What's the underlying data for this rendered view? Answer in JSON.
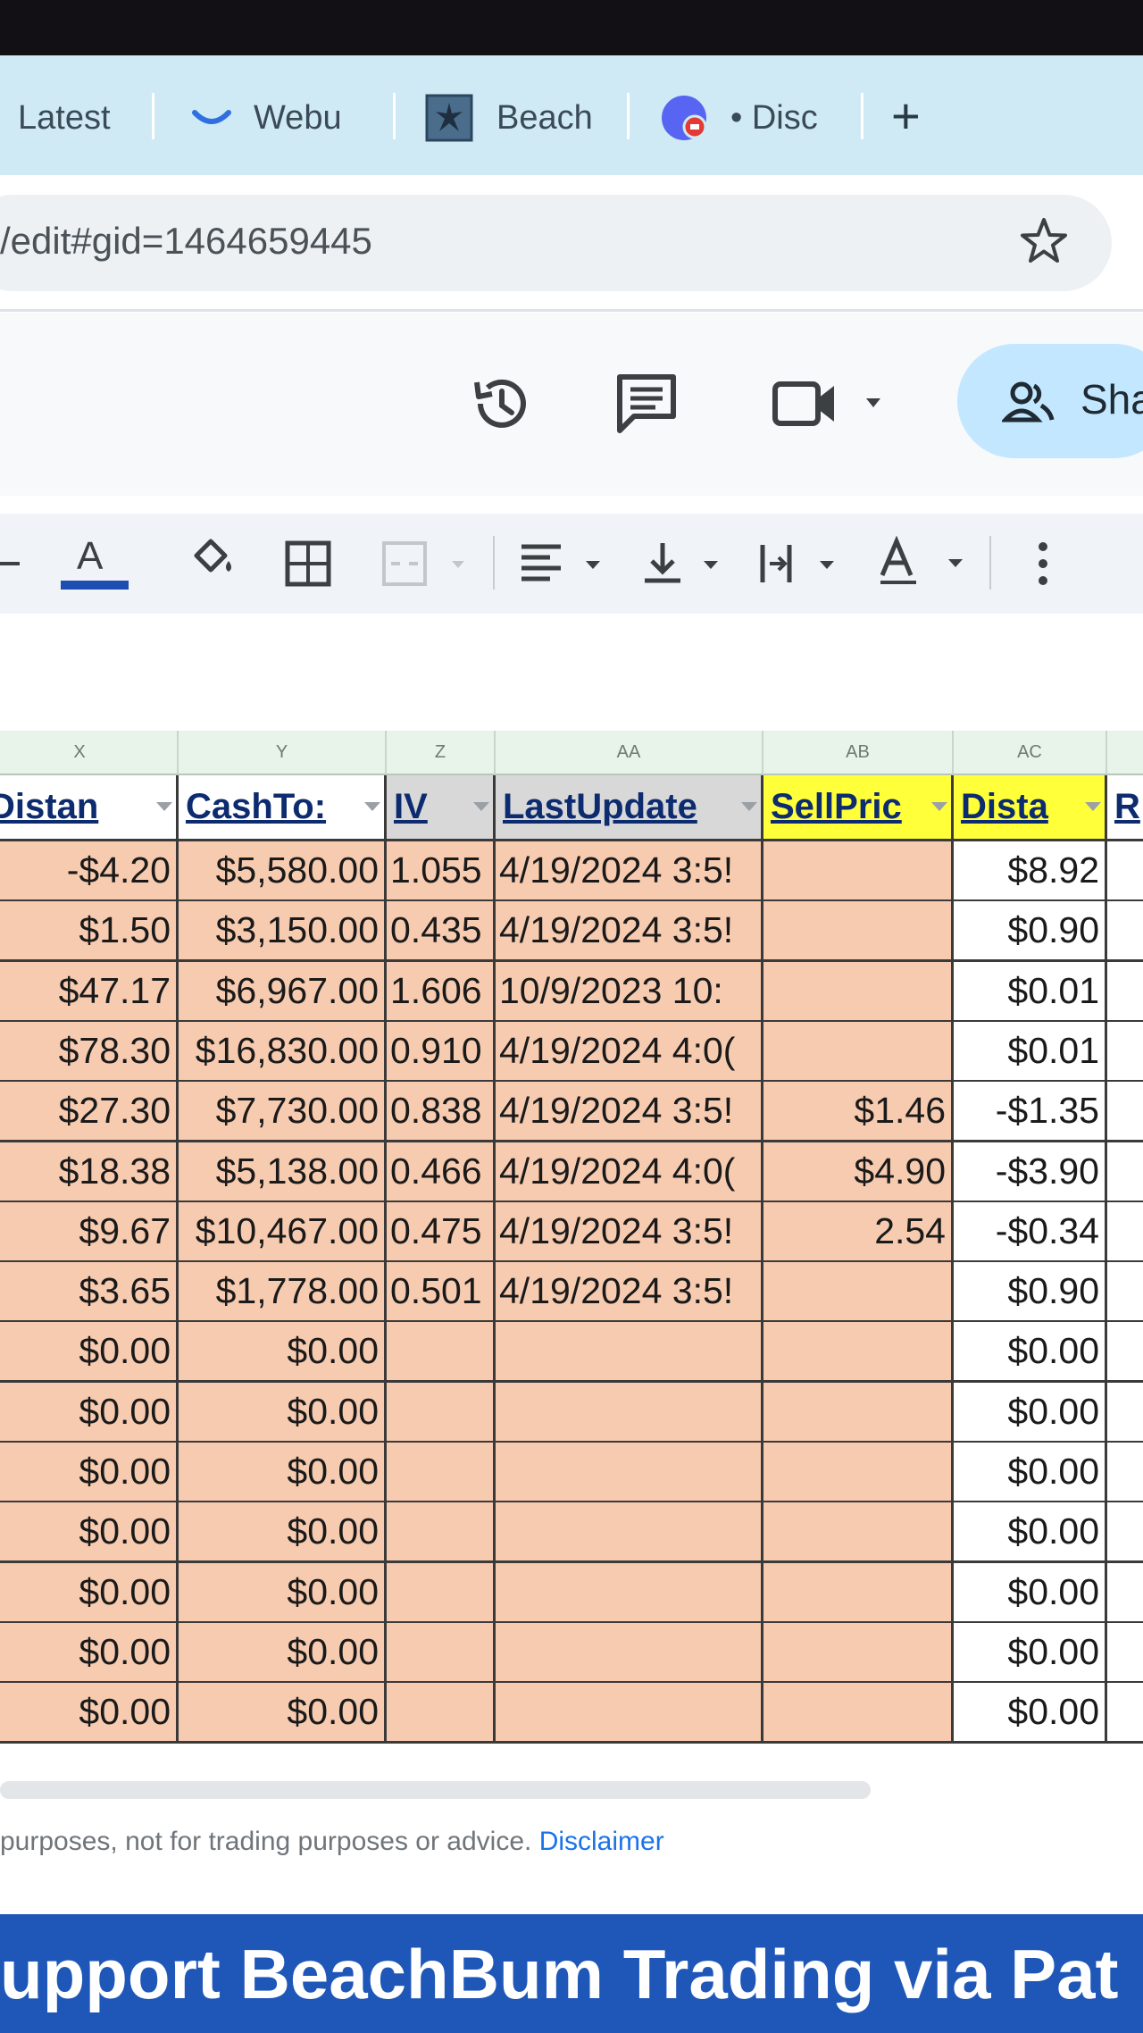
{
  "browser": {
    "tabs": [
      {
        "label": "Latest"
      },
      {
        "label": "Webu"
      },
      {
        "label": "Beach"
      },
      {
        "label": "• Disc"
      }
    ],
    "new_tab": "+",
    "url": "/edit#gid=1464659445"
  },
  "header": {
    "share_label": "Sha"
  },
  "toolbar": {
    "text_color_letter": "A"
  },
  "sheet": {
    "column_letters": [
      "X",
      "Y",
      "Z",
      "AA",
      "AB",
      "AC"
    ],
    "headers": [
      "Distan",
      "CashTo:",
      "IV",
      "LastUpdate",
      "SellPric",
      "Dista",
      "R"
    ],
    "rows": [
      [
        "-$4.20",
        "$5,580.00",
        "1.055",
        "4/19/2024 3:5!",
        "",
        "$8.92"
      ],
      [
        "$1.50",
        "$3,150.00",
        "0.435",
        "4/19/2024 3:5!",
        "",
        "$0.90"
      ],
      [
        "$47.17",
        "$6,967.00",
        "1.606",
        "10/9/2023 10:",
        "",
        "$0.01"
      ],
      [
        "$78.30",
        "$16,830.00",
        "0.910",
        "4/19/2024 4:0(",
        "",
        "$0.01"
      ],
      [
        "$27.30",
        "$7,730.00",
        "0.838",
        "4/19/2024 3:5!",
        "$1.46",
        "-$1.35"
      ],
      [
        "$18.38",
        "$5,138.00",
        "0.466",
        "4/19/2024 4:0(",
        "$4.90",
        "-$3.90"
      ],
      [
        "$9.67",
        "$10,467.00",
        "0.475",
        "4/19/2024 3:5!",
        "2.54",
        "-$0.34"
      ],
      [
        "$3.65",
        "$1,778.00",
        "0.501",
        "4/19/2024 3:5!",
        "",
        "$0.90"
      ],
      [
        "$0.00",
        "$0.00",
        "",
        "",
        "",
        "$0.00"
      ],
      [
        "$0.00",
        "$0.00",
        "",
        "",
        "",
        "$0.00"
      ],
      [
        "$0.00",
        "$0.00",
        "",
        "",
        "",
        "$0.00"
      ],
      [
        "$0.00",
        "$0.00",
        "",
        "",
        "",
        "$0.00"
      ],
      [
        "$0.00",
        "$0.00",
        "",
        "",
        "",
        "$0.00"
      ],
      [
        "$0.00",
        "$0.00",
        "",
        "",
        "",
        "$0.00"
      ],
      [
        "$0.00",
        "$0.00",
        "",
        "",
        "",
        "$0.00"
      ]
    ]
  },
  "footer": {
    "text": "purposes, not for trading purposes or advice.",
    "link": "Disclaimer"
  },
  "banner": {
    "text": "upport BeachBum Trading via Pat"
  },
  "colors": {
    "cell_peach": "#f7cbb0",
    "header_yellow": "#ffff3a",
    "header_gray": "#d8d8d8",
    "banner_blue": "#1f57b8",
    "tab_strip": "#cfeaf4",
    "share_button": "#c2e7ff"
  },
  "icons": [
    "webull-icon",
    "beach-icon",
    "discord-icon",
    "star-icon",
    "history-icon",
    "comment-icon",
    "video-icon",
    "people-icon",
    "strikethrough-icon",
    "text-color-icon",
    "fill-color-icon",
    "borders-icon",
    "merge-cells-icon",
    "align-icon",
    "valign-icon",
    "text-wrap-icon",
    "text-rotate-icon",
    "more-icon"
  ]
}
